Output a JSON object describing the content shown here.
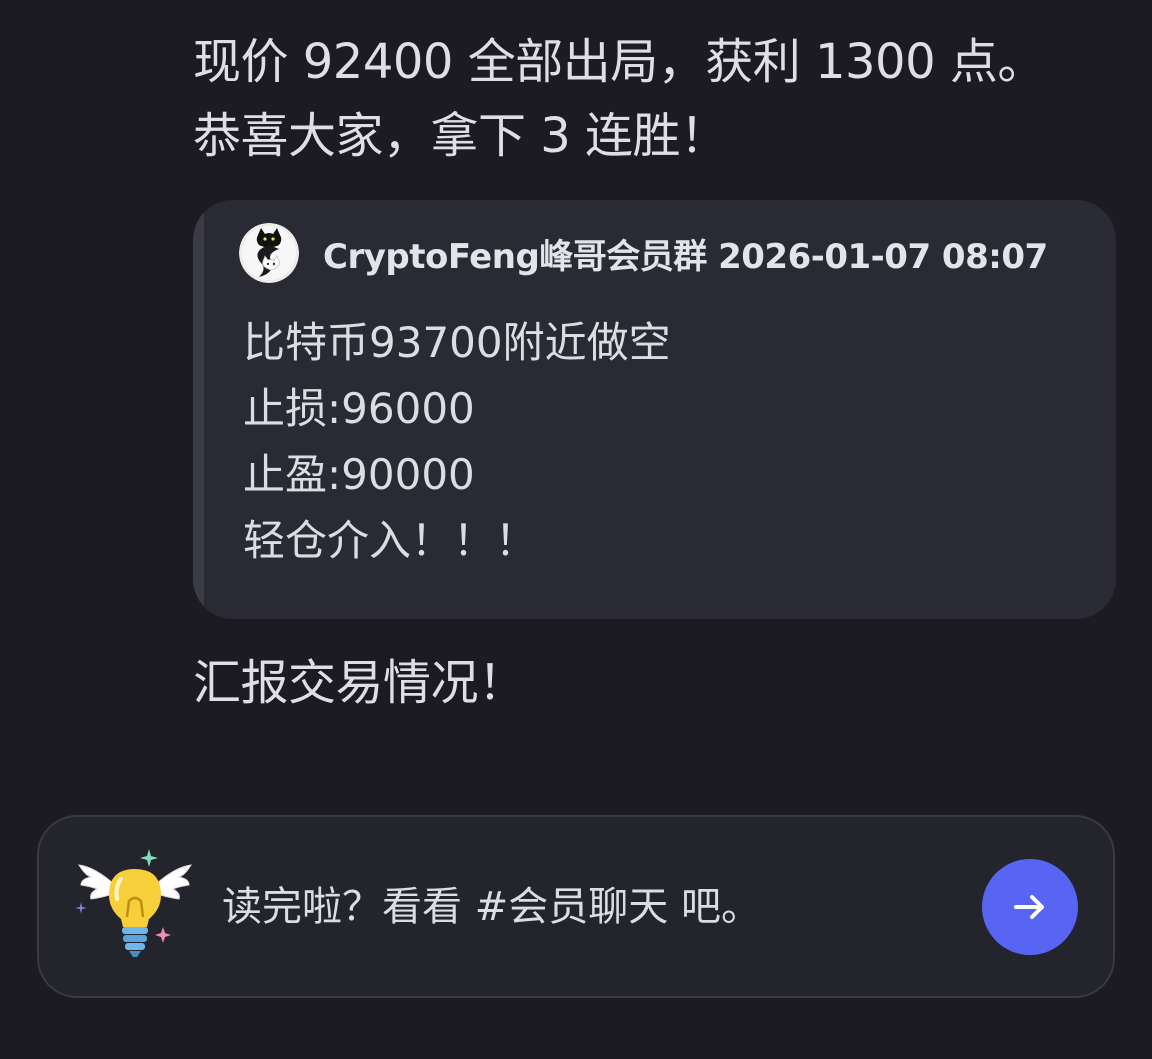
{
  "messages": {
    "top_line_1": "现价 92400 全部出局，获利 1300 点。",
    "top_line_2": "恭喜大家，拿下 3 连胜！",
    "bottom": "汇报交易情况！"
  },
  "quote": {
    "header": "CryptoFeng峰哥会员群 2026-01-07 08:07",
    "lines": [
      "比特币93700附近做空",
      "止损:96000",
      "止盈:90000",
      "轻仓介入！！！"
    ],
    "avatar_icon": "cat-avatar-icon"
  },
  "prompt": {
    "text": "读完啦？看看 #会员聊天 吧。",
    "icon": "winged-lightbulb-icon",
    "button_icon": "arrow-right-icon",
    "button_color": "#5865f2"
  }
}
